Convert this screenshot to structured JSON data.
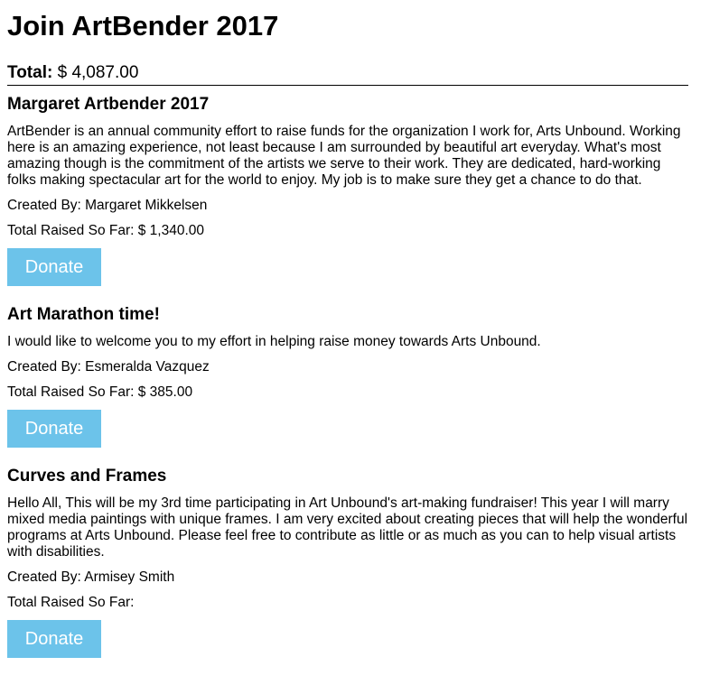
{
  "page": {
    "title": "Join ArtBender 2017",
    "total_label": "Total:",
    "total_value": "$ 4,087.00"
  },
  "campaigns": [
    {
      "title": "Margaret Artbender 2017",
      "description": "ArtBender is an annual community effort to raise funds for the organization I work for, Arts Unbound. Working here is an amazing experience, not least because I am surrounded by beautiful art everyday. What's most amazing though is the commitment of the artists we serve to their work. They are dedicated, hard-working folks making spectacular art for the world to enjoy. My job is to make sure they get a chance to do that.",
      "created_by": "Created By: Margaret Mikkelsen",
      "raised": "Total Raised So Far: $ 1,340.00",
      "donate_label": "Donate"
    },
    {
      "title": "Art Marathon time!",
      "description": "I would like to welcome you to my effort in helping raise money towards Arts Unbound.",
      "created_by": "Created By: Esmeralda Vazquez",
      "raised": "Total Raised So Far: $ 385.00",
      "donate_label": "Donate"
    },
    {
      "title": "Curves and Frames",
      "description": "Hello All, This will be my 3rd time participating in Art Unbound's art-making fundraiser! This year I will marry mixed media paintings with unique frames. I am very excited about creating pieces that will help the wonderful programs at Arts Unbound. Please feel free to contribute as little or as much as you can to help visual artists with disabilities.",
      "created_by": "Created By: Armisey Smith",
      "raised": "Total Raised So Far:",
      "donate_label": "Donate"
    }
  ],
  "colors": {
    "donate_button": "#6cc3ea",
    "donate_text": "#ffffff"
  }
}
